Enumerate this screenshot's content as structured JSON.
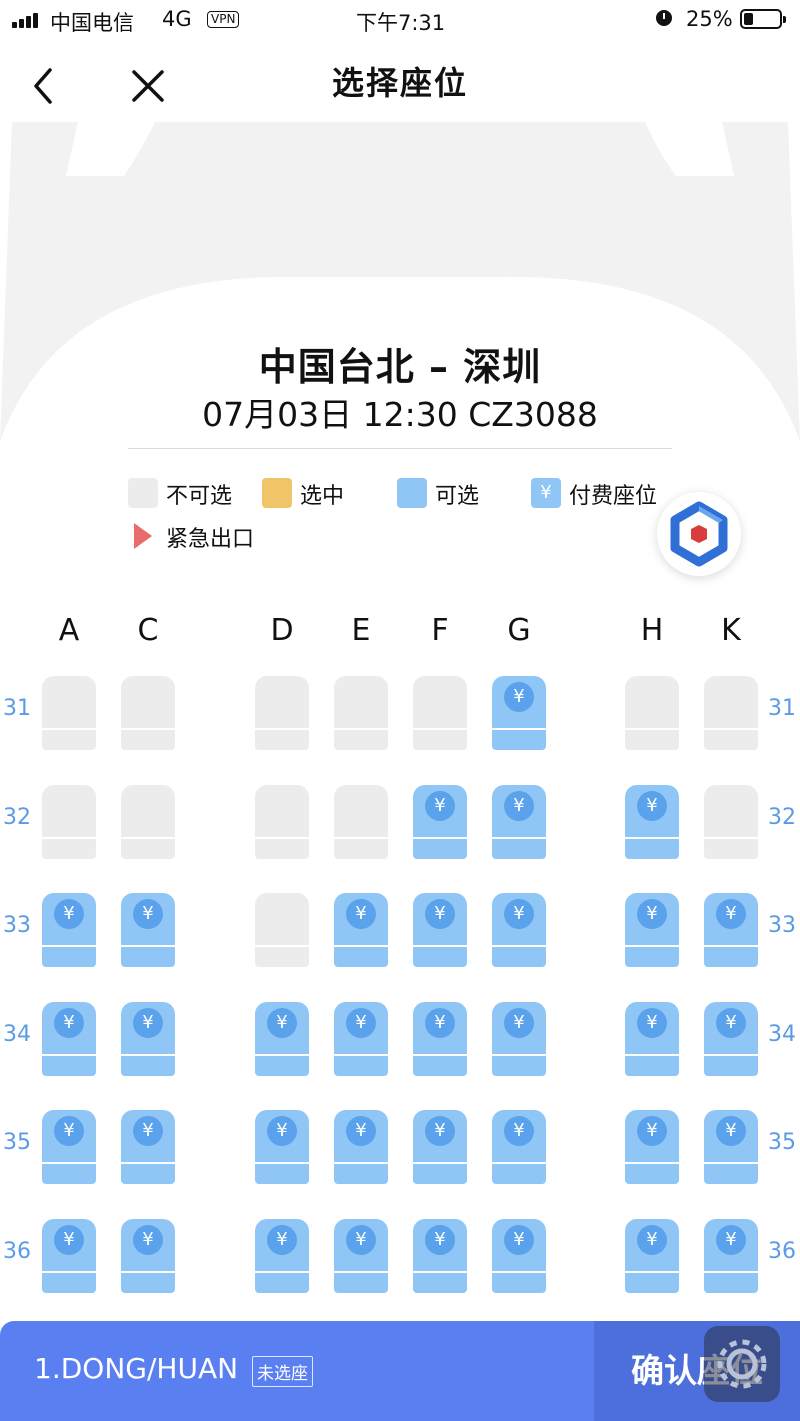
{
  "status_bar": {
    "carrier": "中国电信",
    "network": "4G",
    "vpn": "VPN",
    "time": "下午7:31",
    "battery": "25%"
  },
  "nav": {
    "title": "选择座位"
  },
  "flight": {
    "route": "中国台北 – 深圳",
    "info": "07月03日 12:30 CZ3088"
  },
  "legend": {
    "unavailable": "不可选",
    "selected": "选中",
    "available": "可选",
    "paid": "付费座位",
    "paid_symbol": "¥",
    "exit": "紧急出口"
  },
  "colors": {
    "unavailable": "#ececec",
    "selected": "#f2c46a",
    "available": "#90c6f5",
    "exit": "#e96b6b",
    "accent": "#5a7ff0"
  },
  "columns": [
    "A",
    "C",
    "D",
    "E",
    "F",
    "G",
    "H",
    "K"
  ],
  "rows": [
    {
      "label": "31",
      "seats": [
        "na",
        "na",
        "na",
        "na",
        "na",
        "paid",
        "na",
        "na"
      ]
    },
    {
      "label": "32",
      "seats": [
        "na",
        "na",
        "na",
        "na",
        "paid",
        "paid",
        "paid",
        "na"
      ]
    },
    {
      "label": "33",
      "seats": [
        "paid",
        "paid",
        "na",
        "paid",
        "paid",
        "paid",
        "paid",
        "paid"
      ]
    },
    {
      "label": "34",
      "seats": [
        "paid",
        "paid",
        "paid",
        "paid",
        "paid",
        "paid",
        "paid",
        "paid"
      ]
    },
    {
      "label": "35",
      "seats": [
        "paid",
        "paid",
        "paid",
        "paid",
        "paid",
        "paid",
        "paid",
        "paid"
      ]
    },
    {
      "label": "36",
      "seats": [
        "paid",
        "paid",
        "paid",
        "paid",
        "paid",
        "paid",
        "paid",
        "paid"
      ]
    }
  ],
  "bottom": {
    "passenger": "1.DONG/HUAN",
    "passenger_status": "未选座",
    "confirm": "确认座位"
  }
}
